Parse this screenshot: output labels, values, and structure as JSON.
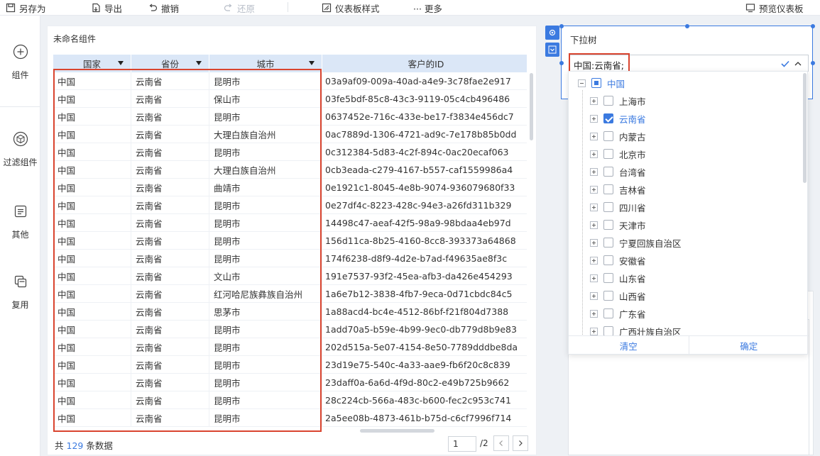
{
  "toolbar": {
    "save_as": "另存为",
    "export": "导出",
    "undo": "撤销",
    "redo": "还原",
    "dashboard_style": "仪表板样式",
    "more": "··· 更多",
    "preview": "预览仪表板"
  },
  "sidebar": {
    "items": [
      {
        "label": "组件",
        "icon": "plus-circle-icon"
      },
      {
        "label": "过滤组件",
        "icon": "cube-icon"
      },
      {
        "label": "其他",
        "icon": "document-icon"
      },
      {
        "label": "复用",
        "icon": "copy-icon"
      }
    ]
  },
  "table_widget": {
    "title": "未命名组件",
    "columns": [
      "国家",
      "省份",
      "城市",
      "客户的ID"
    ],
    "rows": [
      [
        "中国",
        "云南省",
        "昆明市",
        "03a9af09-009a-40ad-a4e9-3c78fae2e917"
      ],
      [
        "中国",
        "云南省",
        "保山市",
        "03fe5bdf-85c8-43c3-9119-05c4cb496486"
      ],
      [
        "中国",
        "云南省",
        "昆明市",
        "0637452e-716c-433e-be17-f3834e456dc7"
      ],
      [
        "中国",
        "云南省",
        "大理白族自治州",
        "0ac7889d-1306-4721-ad9c-7e178b85b0dd"
      ],
      [
        "中国",
        "云南省",
        "昆明市",
        "0c312384-5d83-4c2f-894c-0ac20ecaf063"
      ],
      [
        "中国",
        "云南省",
        "大理白族自治州",
        "0cb3eada-c279-4167-b557-caf1559986a4"
      ],
      [
        "中国",
        "云南省",
        "曲靖市",
        "0e1921c1-8045-4e8b-9074-936079680f33"
      ],
      [
        "中国",
        "云南省",
        "昆明市",
        "0e27df4c-8223-428c-94e3-a26fd311b329"
      ],
      [
        "中国",
        "云南省",
        "昆明市",
        "14498c47-aeaf-42f5-98a9-98bdaa4eb97d"
      ],
      [
        "中国",
        "云南省",
        "昆明市",
        "156d11ca-8b25-4160-8cc8-393373a64868"
      ],
      [
        "中国",
        "云南省",
        "昆明市",
        "174f6238-d8f9-4d2e-b7ad-f49635ae8f3c"
      ],
      [
        "中国",
        "云南省",
        "文山市",
        "191e7537-93f2-45ea-afb3-da426e454293"
      ],
      [
        "中国",
        "云南省",
        "红河哈尼族彝族自治州",
        "1a6e7b12-3838-4fb7-9eca-0d71cbdc84c5"
      ],
      [
        "中国",
        "云南省",
        "思茅市",
        "1a88acd4-bc4e-4512-86bf-f21f804d7388"
      ],
      [
        "中国",
        "云南省",
        "昆明市",
        "1add70a5-b59e-4b99-9ec0-db779d8b9e83"
      ],
      [
        "中国",
        "云南省",
        "昆明市",
        "202d515a-5e07-4154-8e50-7789dddbe8da"
      ],
      [
        "中国",
        "云南省",
        "昆明市",
        "23d19e75-540c-4a33-aae9-fb6f20c8c839"
      ],
      [
        "中国",
        "云南省",
        "昆明市",
        "23daff0a-6a6d-4f9d-80c2-e49b725b9662"
      ],
      [
        "中国",
        "云南省",
        "昆明市",
        "28c224cb-566a-483c-b600-fec2c953c741"
      ],
      [
        "中国",
        "云南省",
        "昆明市",
        "2a5ee08b-4873-461b-b75d-c6cf7996f714"
      ]
    ],
    "footer": {
      "prefix": "共",
      "count": "129",
      "suffix": "条数据"
    },
    "pager": {
      "current": "1",
      "total": "/2"
    }
  },
  "tree_widget": {
    "title": "下拉树",
    "value": "中国:云南省;",
    "root": {
      "label": "中国",
      "state": "partial"
    },
    "children": [
      {
        "label": "上海市",
        "checked": false
      },
      {
        "label": "云南省",
        "checked": true
      },
      {
        "label": "内蒙古",
        "checked": false
      },
      {
        "label": "北京市",
        "checked": false
      },
      {
        "label": "台湾省",
        "checked": false
      },
      {
        "label": "吉林省",
        "checked": false
      },
      {
        "label": "四川省",
        "checked": false
      },
      {
        "label": "天津市",
        "checked": false
      },
      {
        "label": "宁夏回族自治区",
        "checked": false
      },
      {
        "label": "安徽省",
        "checked": false
      },
      {
        "label": "山东省",
        "checked": false
      },
      {
        "label": "山西省",
        "checked": false
      },
      {
        "label": "广东省",
        "checked": false
      },
      {
        "label": "广西壮族自治区",
        "checked": false
      }
    ],
    "clear_label": "清空",
    "confirm_label": "确定"
  },
  "colors": {
    "accent": "#3b7ae0",
    "highlight": "#d9442f",
    "header_bg": "#dbe7f7"
  }
}
